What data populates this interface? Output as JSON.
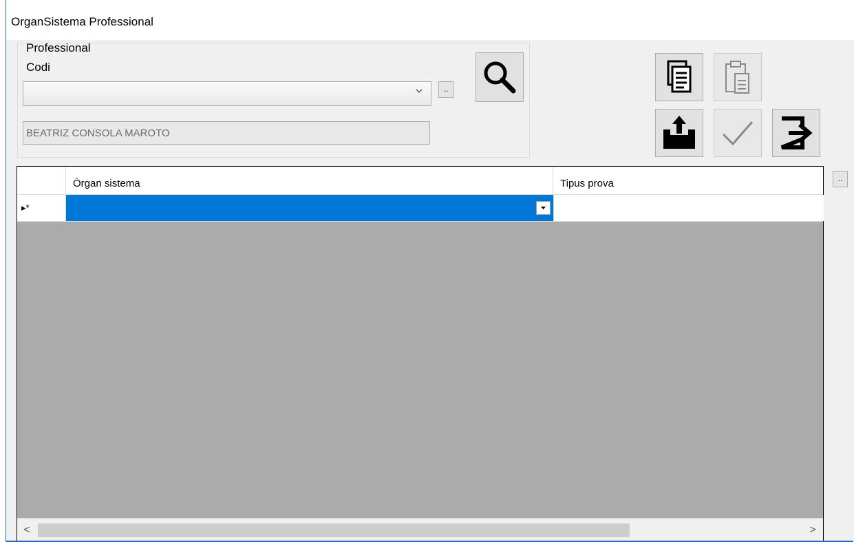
{
  "window": {
    "title": "OrganSistema Professional"
  },
  "professional_group": {
    "title": "Professional",
    "codi_label": "Codi",
    "codi_value": "",
    "ellipsis_label": "..",
    "name_value": "BEATRIZ CONSOLA MAROTO"
  },
  "toolbar": {
    "search_icon": "search-icon",
    "copy_icon": "copy-document-icon",
    "paste_icon": "paste-clipboard-icon",
    "export_icon": "export-folder-icon",
    "confirm_icon": "check-icon",
    "exit_icon": "exit-arrow-icon"
  },
  "grid": {
    "columns": [
      "Òrgan sistema",
      "Tipus prova"
    ],
    "new_row_marker": "▸*",
    "side_button_label": "..",
    "scroll_left": "<",
    "scroll_right": ">"
  },
  "colors": {
    "selection": "#0078d7",
    "grid_empty": "#ababab",
    "window_border": "#2b6cc4"
  }
}
